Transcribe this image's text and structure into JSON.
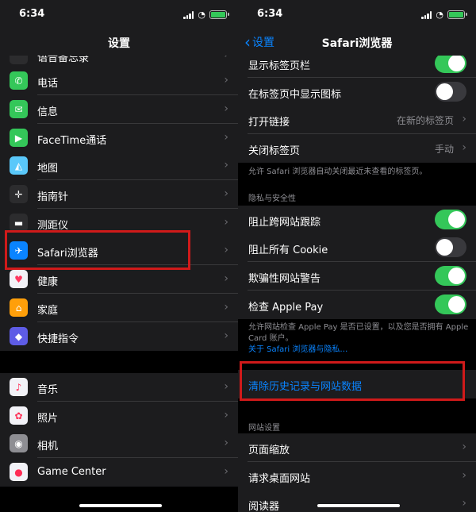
{
  "status": {
    "time": "6:34"
  },
  "left": {
    "title": "设置",
    "partial_item": "语音备忘录",
    "items": [
      {
        "label": "电话",
        "icon": "phone-icon",
        "color": "#34c759",
        "glyph": "✆"
      },
      {
        "label": "信息",
        "icon": "messages-icon",
        "color": "#34c759",
        "glyph": "✉"
      },
      {
        "label": "FaceTime通话",
        "icon": "facetime-icon",
        "color": "#34c759",
        "glyph": "▶"
      },
      {
        "label": "地图",
        "icon": "maps-icon",
        "color": "#5ac8fa",
        "glyph": "◭"
      },
      {
        "label": "指南针",
        "icon": "compass-icon",
        "color": "#2c2c2e",
        "glyph": "✛"
      },
      {
        "label": "测距仪",
        "icon": "measure-icon",
        "color": "#2c2c2e",
        "glyph": "▬"
      },
      {
        "label": "Safari浏览器",
        "icon": "safari-icon",
        "color": "#0a84ff",
        "glyph": "✈"
      },
      {
        "label": "健康",
        "icon": "health-icon",
        "color": "#f2f2f7",
        "glyph": "♥"
      },
      {
        "label": "家庭",
        "icon": "home-icon",
        "color": "#ff9f0a",
        "glyph": "⌂"
      },
      {
        "label": "快捷指令",
        "icon": "shortcuts-icon",
        "color": "#5e5ce6",
        "glyph": "◆"
      }
    ],
    "items2": [
      {
        "label": "音乐",
        "icon": "music-icon",
        "color": "#f2f2f7",
        "glyph": "♪"
      },
      {
        "label": "照片",
        "icon": "photos-icon",
        "color": "#f2f2f7",
        "glyph": "✿"
      },
      {
        "label": "相机",
        "icon": "camera-icon",
        "color": "#8e8e93",
        "glyph": "◉"
      },
      {
        "label": "Game Center",
        "icon": "game-center-icon",
        "color": "#f2f2f7",
        "glyph": "●"
      }
    ]
  },
  "right": {
    "back_label": "设置",
    "title": "Safari浏览器",
    "tabs_rows": [
      {
        "label": "显示标签页栏",
        "toggle": true
      },
      {
        "label": "在标签页中显示图标",
        "toggle": false
      },
      {
        "label": "打开链接",
        "value": "在新的标签页"
      },
      {
        "label": "关闭标签页",
        "value": "手动"
      }
    ],
    "tabs_footnote": "允许 Safari 浏览器自动关闭最近未查看的标签页。",
    "privacy_header": "隐私与安全性",
    "privacy_rows": [
      {
        "label": "阻止跨网站跟踪",
        "toggle": true
      },
      {
        "label": "阻止所有 Cookie",
        "toggle": false
      },
      {
        "label": "欺骗性网站警告",
        "toggle": true
      },
      {
        "label": "检查 Apple Pay",
        "toggle": true
      }
    ],
    "privacy_footnote": "允许网站检查 Apple Pay 是否已设置，以及您是否拥有 Apple Card 账户。",
    "privacy_link": "关于 Safari 浏览器与隐私…",
    "clear_label": "清除历史记录与网站数据",
    "website_header": "网站设置",
    "website_rows": [
      {
        "label": "页面缩放"
      },
      {
        "label": "请求桌面网站"
      },
      {
        "label": "阅读器"
      }
    ]
  },
  "colors": {
    "accent": "#0a84ff",
    "toggle_on": "#34c759",
    "highlight": "#d01a1a"
  }
}
